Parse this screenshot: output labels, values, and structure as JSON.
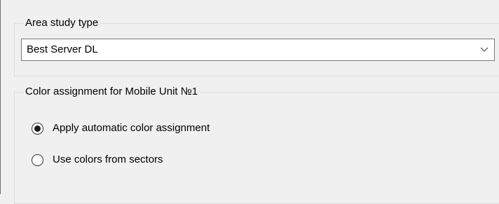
{
  "area_study": {
    "legend": "Area study type",
    "selected_value": "Best Server DL",
    "dropdown_icon": "chevron-down-icon"
  },
  "color_assignment": {
    "legend": "Color assignment for Mobile Unit №1",
    "options": [
      {
        "label": "Apply automatic color assignment",
        "checked": true
      },
      {
        "label": "Use colors from sectors",
        "checked": false
      }
    ]
  }
}
